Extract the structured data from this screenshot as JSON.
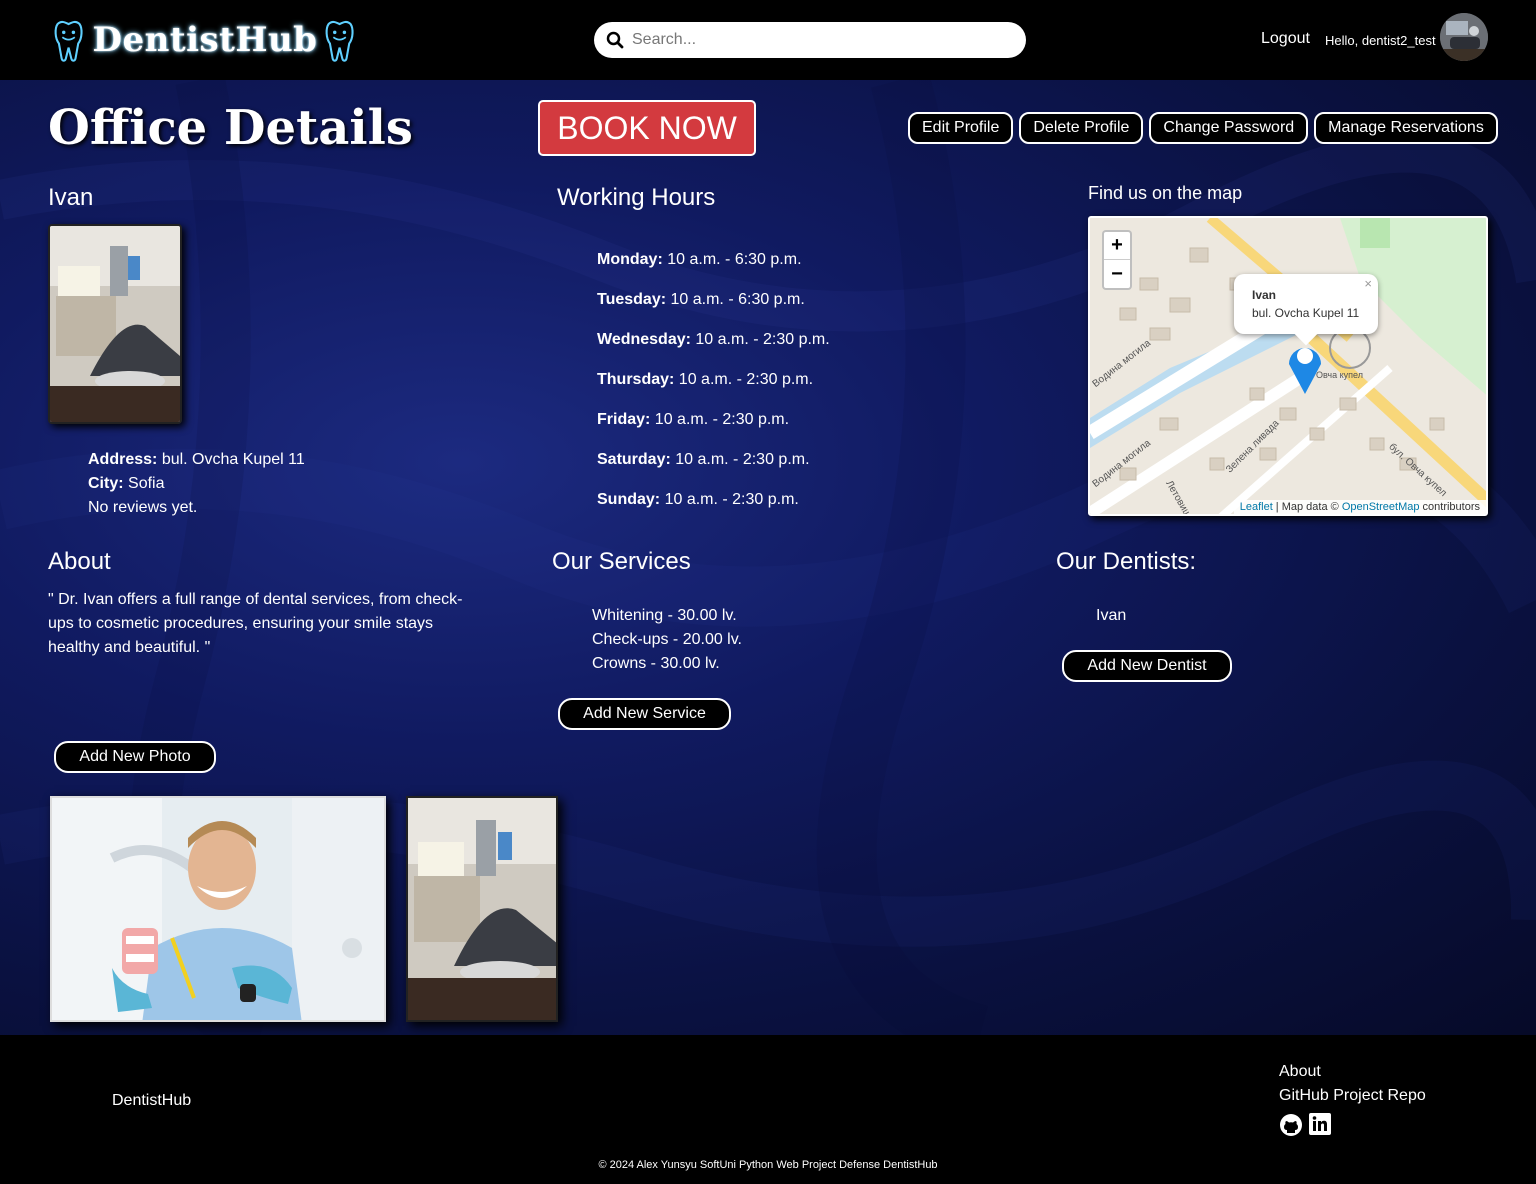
{
  "nav": {
    "brand": "DentistHub",
    "search_placeholder": "Search...",
    "logout": "Logout",
    "greeting": "Hello, dentist2_test"
  },
  "header": {
    "title": "Office Details",
    "book_now": "BOOK NOW",
    "buttons": {
      "edit": "Edit Profile",
      "delete": "Delete Profile",
      "change_password": "Change Password",
      "reservations": "Manage Reservations"
    }
  },
  "office": {
    "name": "Ivan",
    "address_label": "Address:",
    "address": "bul. Ovcha Kupel 11",
    "city_label": "City:",
    "city": "Sofia",
    "reviews": "No reviews yet."
  },
  "working_hours": {
    "title": "Working Hours",
    "days": [
      {
        "day": "Monday:",
        "hours": "10 a.m. - 6:30 p.m."
      },
      {
        "day": "Tuesday:",
        "hours": "10 a.m. - 6:30 p.m."
      },
      {
        "day": "Wednesday:",
        "hours": "10 a.m. - 2:30 p.m."
      },
      {
        "day": "Thursday:",
        "hours": "10 a.m. - 2:30 p.m."
      },
      {
        "day": "Friday:",
        "hours": "10 a.m. - 2:30 p.m."
      },
      {
        "day": "Saturday:",
        "hours": "10 a.m. - 2:30 p.m."
      },
      {
        "day": "Sunday:",
        "hours": "10 a.m. - 2:30 p.m."
      }
    ]
  },
  "map": {
    "title": "Find us on the map",
    "zoom_in": "+",
    "zoom_out": "−",
    "popup_name": "Ivan",
    "popup_address": "bul. Ovcha Kupel 11",
    "popup_close": "×",
    "attr_leaflet": "Leaflet",
    "attr_mid": " | Map data © ",
    "attr_osm": "OpenStreetMap",
    "attr_end": " contributors",
    "street_labels": [
      "Вoдина могила",
      "Вoдина могила",
      "Зелена ливада",
      "Летовища",
      "бул. Овча купел",
      "Овча купел"
    ]
  },
  "about": {
    "title": "About",
    "text": "\" Dr. Ivan offers a full range of dental services, from check-ups to cosmetic procedures, ensuring your smile stays healthy and beautiful. \"",
    "add_photo": "Add New Photo"
  },
  "services": {
    "title": "Our Services",
    "items": [
      "Whitening - 30.00 lv.",
      "Check-ups - 20.00 lv.",
      "Crowns - 30.00 lv."
    ],
    "add": "Add New Service"
  },
  "dentists": {
    "title": "Our Dentists:",
    "items": [
      "Ivan"
    ],
    "add": "Add New Dentist"
  },
  "footer": {
    "brand": "DentistHub",
    "about": "About",
    "repo": "GitHub Project Repo",
    "copyright": "© 2024 Alex Yunsyu SoftUni Python Web Project Defense DentistHub"
  },
  "icons": {
    "search": "search-icon",
    "github": "github-icon",
    "linkedin": "linkedin-icon",
    "map_pin": "map-pin-icon"
  },
  "colors": {
    "book_now": "#d33a3f",
    "background": "#101a60",
    "brand_glow": "#7fd4ff"
  }
}
